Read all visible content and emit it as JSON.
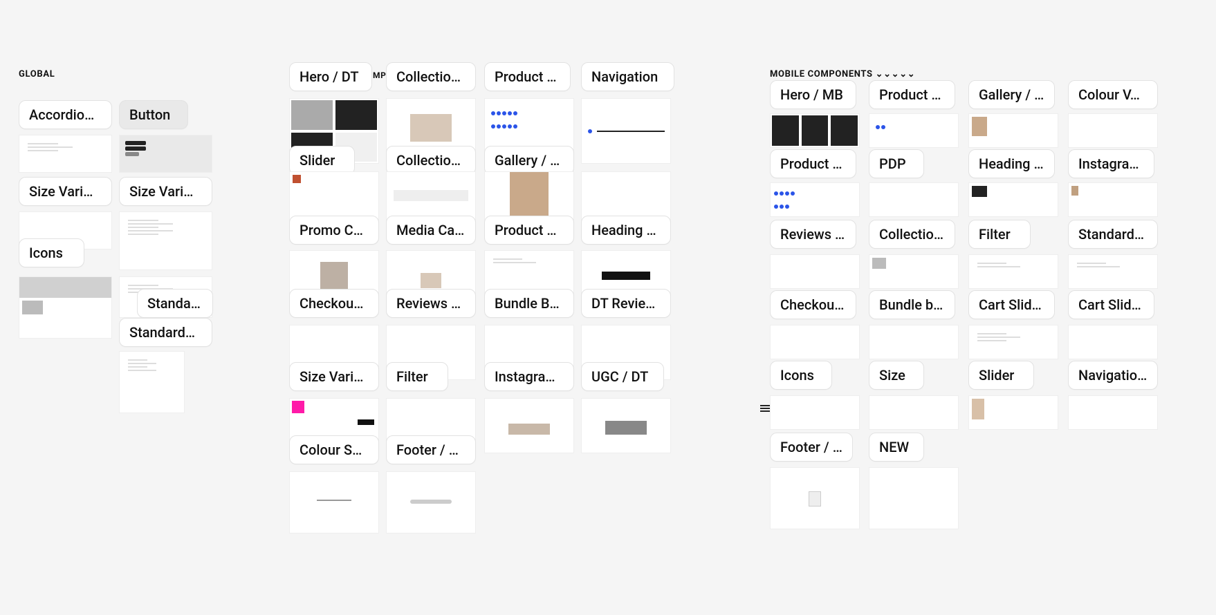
{
  "sections": {
    "global": {
      "title": "GLOBAL",
      "chips": [
        "Accordio…",
        "Button",
        "Size Vari…",
        "Size Vari…",
        "Icons",
        "Standa…",
        "Standard…"
      ]
    },
    "desktop": {
      "title_fragment": "MP",
      "chips": [
        "Hero / DT",
        "Collectio…",
        "Product …",
        "Navigation",
        "Slider",
        "Collectio…",
        "Gallery / …",
        "Promo C…",
        "Media Ca…",
        "Product …",
        "Heading …",
        "Checkou…",
        "Reviews …",
        "Bundle B…",
        "DT Revie…",
        "Size Vari…",
        "Filter",
        "Instagra…",
        "UGC / DT",
        "Colour S…",
        "Footer / DT"
      ]
    },
    "mobile": {
      "title": "MOBILE COMPONENTS ⌄⌄⌄⌄⌄",
      "chips": [
        "Hero / MB",
        "Product …",
        "Gallery / …",
        "Colour V…",
        "Product …",
        "PDP",
        "Heading …",
        "Instagra…",
        "Reviews …",
        "Collectio…",
        "Filter",
        "Standard…",
        "Checkou…",
        "Bundle b…",
        "Cart Slid…",
        "Cart Slid…",
        "Icons",
        "Size",
        "Slider",
        "Navigatio…",
        "Footer / …",
        "NEW"
      ]
    }
  }
}
